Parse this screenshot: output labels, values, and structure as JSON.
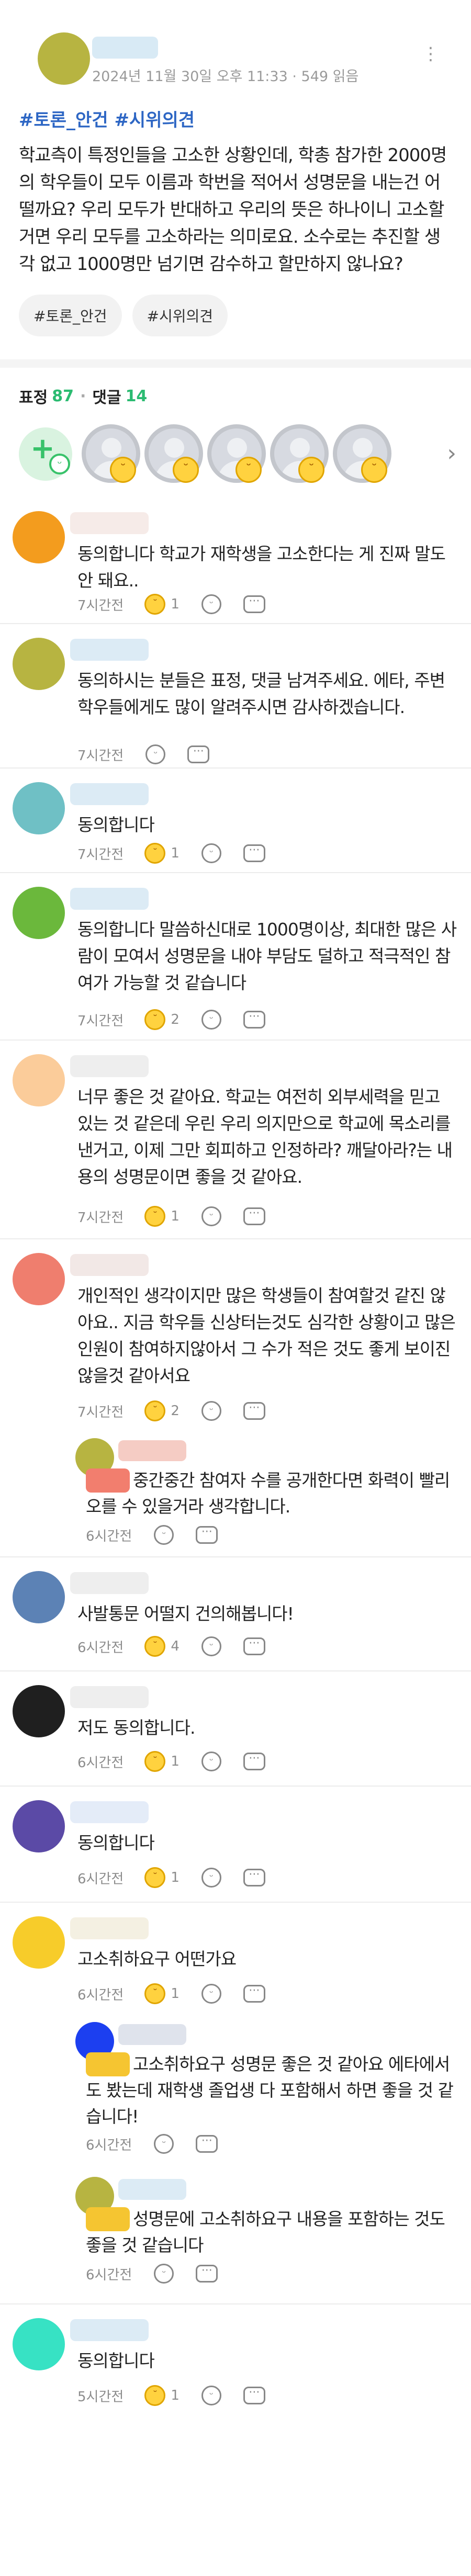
{
  "post": {
    "timestamp": "2024년 11월 30일 오후 11:33",
    "views": "549 읽음",
    "title": "#토론_안건 #시위의견",
    "body": "학교측이 특정인들을 고소한 상황인데, 학총 참가한 2000명의 학우들이 모두 이름과 학번을 적어서 성명문을 내는건 어떨까요? 우리 모두가 반대하고 우리의 뜻은 하나이니 고소할거면 우리 모두를 고소하라는 의미로요. 소수로는 추진할 생각 없고 1000명만 넘기면 감수하고 할만하지 않나요?",
    "tags": [
      "#토론_안건",
      "#시위의견"
    ],
    "colors": {
      "avatar": "#b7b441",
      "title": "#2d66c4"
    }
  },
  "stats": {
    "reactions_label": "표정",
    "reactions_count": "87",
    "comments_label": "댓글",
    "comments_count": "14"
  },
  "comments": [
    {
      "text": "동의합니다 학교가 재학생을 고소한다는 게 진짜 말도 안 돼요..",
      "time": "7시간전",
      "reactions": "1",
      "color": "#f39c1e"
    },
    {
      "text": "동의하시는 분들은 표정, 댓글 남겨주세요. 에타, 주변 학우들에게도 많이 알려주시면 감사하겠습니다.",
      "time": "7시간전",
      "reactions": "",
      "color": "#b7b441"
    },
    {
      "text": "동의합니다",
      "time": "7시간전",
      "reactions": "1",
      "color": "#6fc0c5"
    },
    {
      "text": "동의합니다 말씀하신대로 1000명이상, 최대한 많은 사람이 모여서 성명문을 내야 부담도 덜하고 적극적인 참여가 가능할 것 같습니다",
      "time": "7시간전",
      "reactions": "2",
      "color": "#6bb83c"
    },
    {
      "text": "너무 좋은 것 같아요. 학교는 여전히 외부세력을 믿고 있는 것 같은데 우린 우리 의지만으로 학교에 목소리를 낸거고, 이제 그만 회피하고 인정하라? 깨달아라?는 내용의 성명문이면 좋을 것 같아요.",
      "time": "7시간전",
      "reactions": "1",
      "color": "#fbcc9a"
    },
    {
      "text": "개인적인 생각이지만 많은 학생들이 참여할것 같진 않아요.. 지금 학우들 신상터는것도 심각한 상황이고 많은 인원이 참여하지않아서 그 수가 적은 것도 좋게 보이진 않을것 같아서요",
      "time": "7시간전",
      "reactions": "2",
      "color": "#ef7e6e"
    },
    {
      "text": "사발통문 어떨지 건의해봅니다!",
      "time": "6시간전",
      "reactions": "4",
      "color": "#5c82b5"
    },
    {
      "text": "저도 동의합니다.",
      "time": "6시간전",
      "reactions": "1",
      "color": "#1f1f1f"
    },
    {
      "text": "동의합니다",
      "time": "6시간전",
      "reactions": "1",
      "color": "#5b4aa6"
    },
    {
      "text": "고소취하요구 어떤가요",
      "time": "6시간전",
      "reactions": "1",
      "color": "#f7cc2a"
    },
    {
      "text": "동의합니다",
      "time": "5시간전",
      "reactions": "1",
      "color": "#37e2c4"
    }
  ],
  "replies": [
    {
      "text": "중간중간 참여자 수를 공개한다면 화력이 빨리 오를 수 있을거라 생각합니다.",
      "time": "6시간전",
      "color": "#b7b441"
    },
    {
      "text": "고소취하요구 성명문 좋은 것 같아요 에타에서도 봤는데 재학생 졸업생 다 포함해서 하면 좋을 것 같습니다!",
      "time": "6시간전",
      "color": "#1c3ff0"
    },
    {
      "text": "성명문에 고소취하요구 내용을 포함하는 것도 좋을 것 같습니다",
      "time": "6시간전",
      "color": "#b7b441"
    }
  ]
}
